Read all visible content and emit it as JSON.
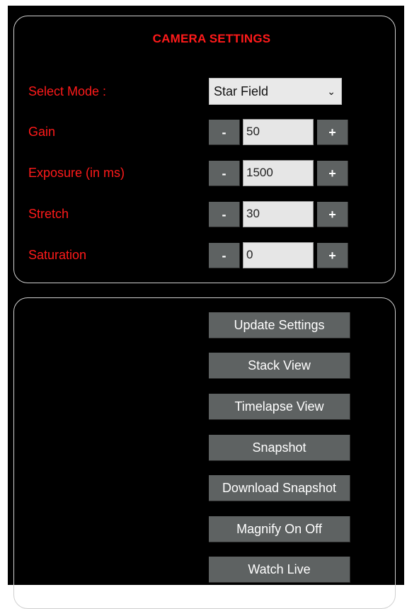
{
  "camera_settings": {
    "title": "CAMERA SETTINGS",
    "mode": {
      "label": "Select Mode :",
      "selected": "Star Field",
      "chevron_icon": "chevron-down-icon"
    },
    "decrement_label": "-",
    "increment_label": "+",
    "fields": [
      {
        "label": "Gain",
        "value": "50"
      },
      {
        "label": "Exposure (in ms)",
        "value": "1500"
      },
      {
        "label": "Stretch",
        "value": "30"
      },
      {
        "label": "Saturation",
        "value": "0"
      }
    ]
  },
  "actions": {
    "buttons": [
      {
        "label": "Update Settings"
      },
      {
        "label": "Stack View"
      },
      {
        "label": "Timelapse View"
      },
      {
        "label": "Snapshot"
      },
      {
        "label": "Download Snapshot"
      },
      {
        "label": "Magnify On Off"
      },
      {
        "label": "Watch Live"
      }
    ]
  },
  "colors": {
    "background": "#000000",
    "label_red": "#ff1a1a",
    "button_gray": "#5e6262",
    "input_bg": "#e6e6e6",
    "panel_border": "#cfcfcf"
  }
}
